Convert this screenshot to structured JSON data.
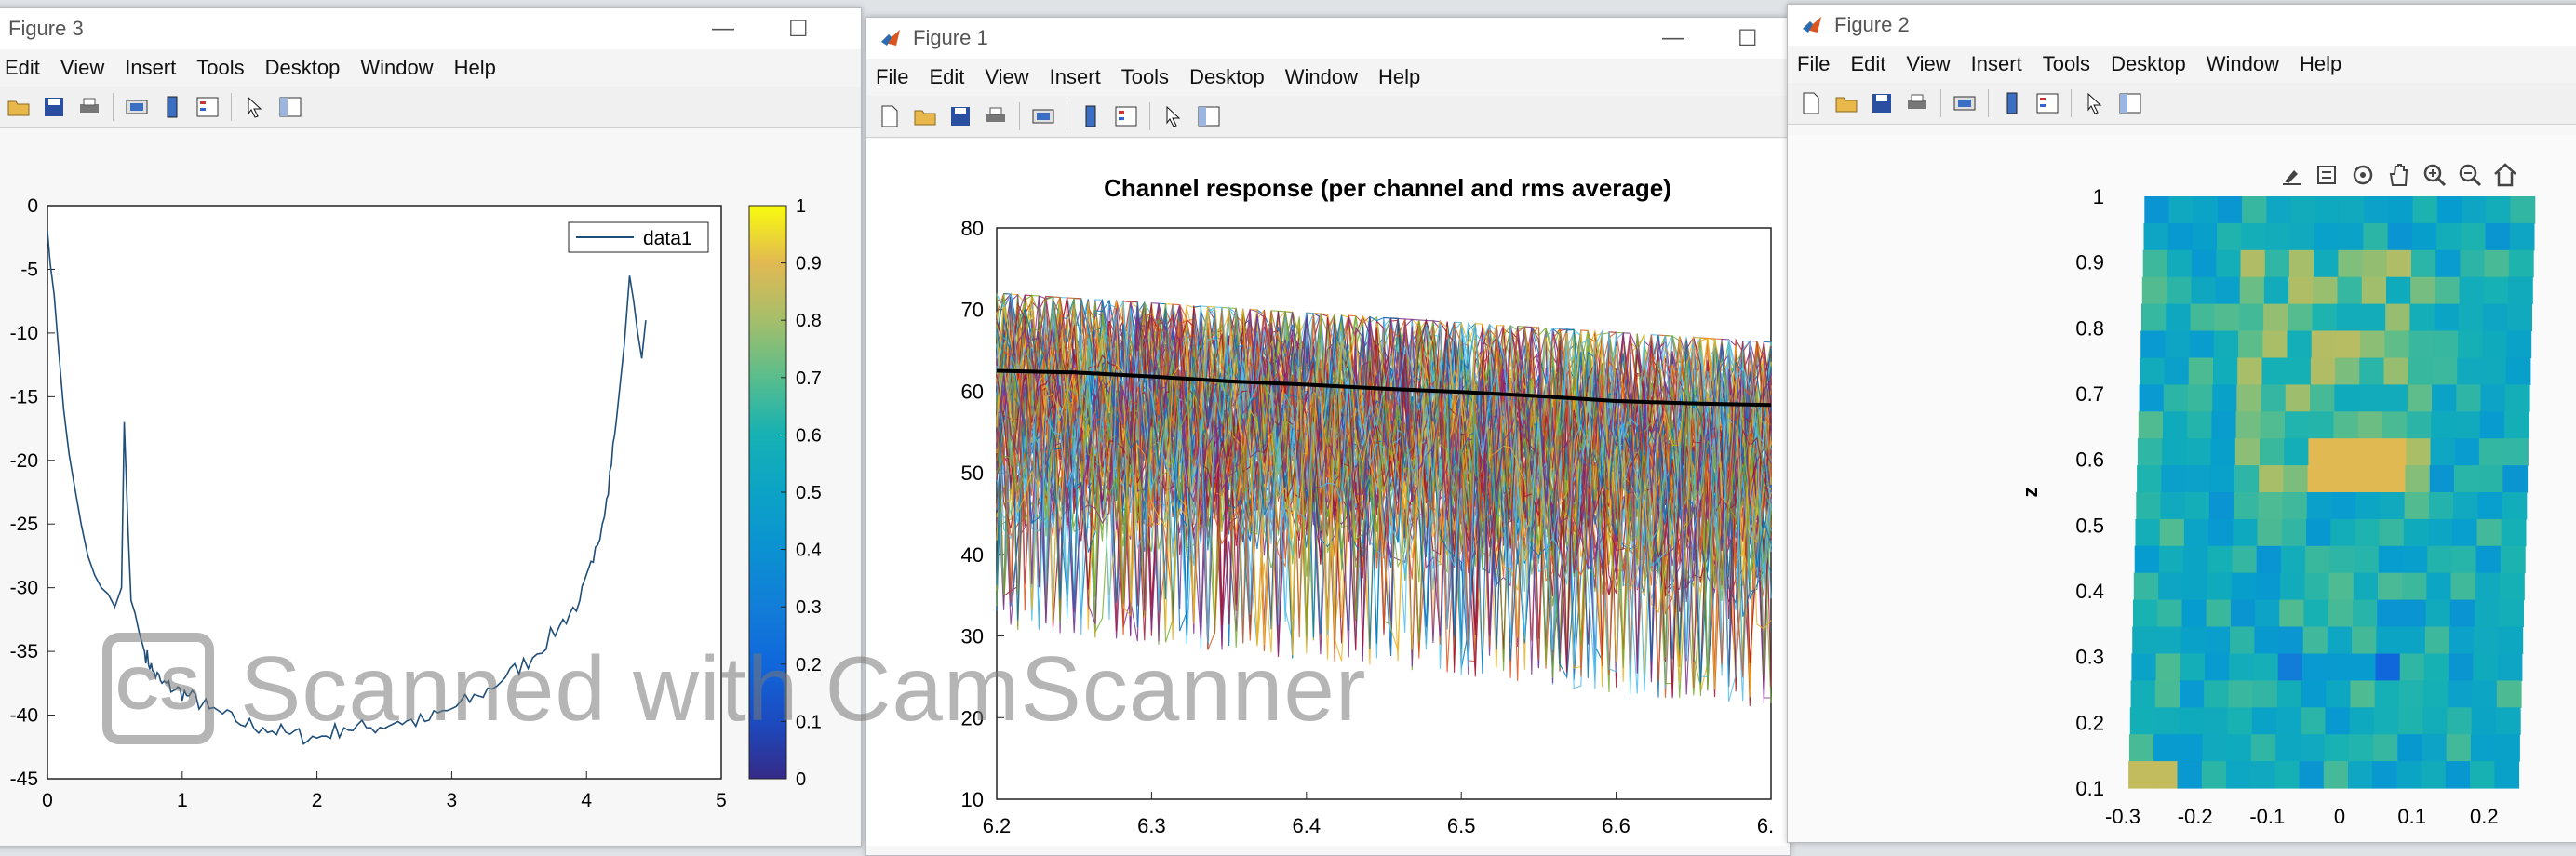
{
  "figure3": {
    "title": "Figure 3",
    "menu": [
      "Edit",
      "View",
      "Insert",
      "Tools",
      "Desktop",
      "Window",
      "Help"
    ],
    "legend": "data1",
    "colorbar_ticks": [
      "1",
      "0.9",
      "0.8",
      "0.7",
      "0.6",
      "0.5",
      "0.4",
      "0.3",
      "0.2",
      "0.1",
      "0"
    ]
  },
  "figure1": {
    "title": "Figure 1",
    "menu": [
      "File",
      "Edit",
      "View",
      "Insert",
      "Tools",
      "Desktop",
      "Window",
      "Help"
    ]
  },
  "figure2": {
    "title": "Figure 2",
    "menu": [
      "File",
      "Edit",
      "View",
      "Insert",
      "Tools",
      "Desktop",
      "Window",
      "Help"
    ]
  },
  "watermark": {
    "logo": "CS",
    "text": "Scanned with CamScanner"
  },
  "chart_data": [
    {
      "type": "line",
      "figure": "Figure 3",
      "title": "",
      "xlabel": "",
      "ylabel": "",
      "xlim": [
        0,
        5
      ],
      "ylim": [
        -45,
        0
      ],
      "xticks": [
        "0",
        "1",
        "2",
        "3",
        "4",
        "5"
      ],
      "yticks": [
        "0",
        "-5",
        "-10",
        "-15",
        "-20",
        "-25",
        "-30",
        "-35",
        "-40",
        "-45"
      ],
      "legend_position": "top-right",
      "series": [
        {
          "name": "data1",
          "color": "#1f4e79",
          "x": [
            0.0,
            0.02,
            0.05,
            0.08,
            0.12,
            0.16,
            0.2,
            0.25,
            0.3,
            0.35,
            0.4,
            0.45,
            0.5,
            0.55,
            0.57,
            0.6,
            0.62,
            0.65,
            0.68,
            0.72,
            0.78,
            0.85,
            0.95,
            1.05,
            1.2,
            1.4,
            1.6,
            1.8,
            2.0,
            2.2,
            2.4,
            2.6,
            2.8,
            3.0,
            3.2,
            3.4,
            3.6,
            3.8,
            3.95,
            4.05,
            4.15,
            4.22,
            4.28,
            4.32,
            4.35,
            4.38,
            4.41,
            4.44
          ],
          "y": [
            -2,
            -4.5,
            -7,
            -11,
            -16,
            -19.5,
            -22,
            -25,
            -27.5,
            -29,
            -30,
            -30.5,
            -31.5,
            -30,
            -17,
            -26,
            -31,
            -32,
            -33.5,
            -35,
            -36.5,
            -37.5,
            -38,
            -38.5,
            -39.5,
            -40.5,
            -41,
            -41.5,
            -41.8,
            -41,
            -41,
            -40.5,
            -40.5,
            -39.5,
            -38.5,
            -37,
            -35.5,
            -33,
            -31,
            -28,
            -23,
            -17,
            -11,
            -5.5,
            -7.5,
            -10,
            -12,
            -9
          ]
        }
      ],
      "colorbar": {
        "range": [
          0,
          1
        ],
        "colormap": "parula"
      }
    },
    {
      "type": "line",
      "figure": "Figure 1",
      "title": "Channel response (per channel and rms average)",
      "xlabel": "",
      "ylabel": "",
      "xlim": [
        6.2,
        6.7
      ],
      "ylim": [
        10,
        80
      ],
      "xticks": [
        "6.2",
        "6.3",
        "6.4",
        "6.5",
        "6.6",
        "6."
      ],
      "yticks": [
        "80",
        "70",
        "60",
        "50",
        "40",
        "30",
        "20",
        "10"
      ],
      "series": [
        {
          "name": "",
          "color": "#000000",
          "x": [
            6.2,
            6.25,
            6.3,
            6.35,
            6.4,
            6.45,
            6.5,
            6.55,
            6.6,
            6.65,
            6.7
          ],
          "y": [
            62.5,
            62.3,
            61.8,
            61.2,
            60.8,
            60.3,
            59.9,
            59.4,
            58.8,
            58.5,
            58.3
          ]
        }
      ],
      "per_channel_band": {
        "upper": [
          72,
          66
        ],
        "lower": [
          35,
          25
        ]
      }
    },
    {
      "type": "heatmap",
      "figure": "Figure 2",
      "title": "",
      "xlabel": "",
      "ylabel": "z",
      "xlim": [
        -0.3,
        0.3
      ],
      "ylim": [
        0.1,
        1
      ],
      "xticks": [
        "-0.3",
        "-0.2",
        "-0.1",
        "0",
        "0.1",
        "0.2"
      ],
      "yticks": [
        "1",
        "0.9",
        "0.8",
        "0.7",
        "0.6",
        "0.5",
        "0.4",
        "0.3",
        "0.2",
        "0.1"
      ],
      "grid_rows": 22,
      "grid_cols": 16,
      "colormap": "parula",
      "value_range": [
        0.35,
        0.9
      ],
      "hot_spots": [
        {
          "x": 0.0,
          "z": 0.6,
          "value": 0.9
        },
        {
          "x": 0.05,
          "z": 0.6,
          "value": 0.9
        },
        {
          "x": -0.25,
          "z": 0.12,
          "value": 0.85
        }
      ],
      "cold_spots": [
        {
          "x": 0.09,
          "z": 0.27,
          "value": 0.2
        },
        {
          "x": -0.04,
          "z": 0.3,
          "value": 0.3
        }
      ]
    }
  ]
}
